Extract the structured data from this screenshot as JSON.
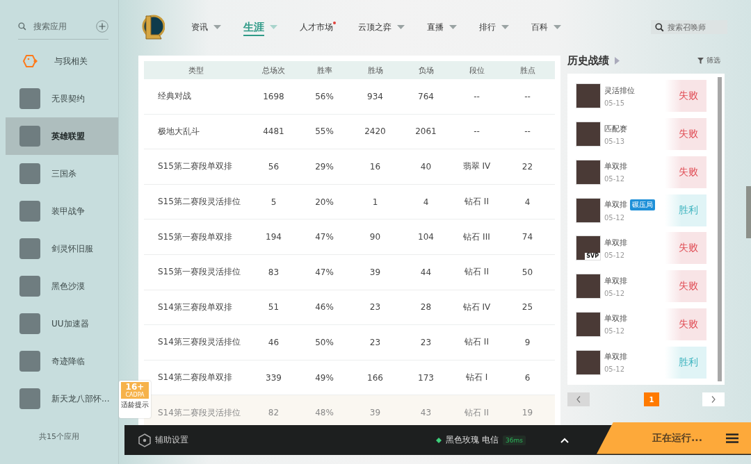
{
  "sidebar": {
    "search": {
      "placeholder": "搜索应用"
    },
    "items": [
      {
        "label": "与我相关",
        "selected": false,
        "kind": "related"
      },
      {
        "label": "无畏契约",
        "selected": false,
        "kind": "game"
      },
      {
        "label": "英雄联盟",
        "selected": true,
        "kind": "game"
      },
      {
        "label": "三国杀",
        "selected": false,
        "kind": "game"
      },
      {
        "label": "装甲战争",
        "selected": false,
        "kind": "game"
      },
      {
        "label": "剑灵怀旧服",
        "selected": false,
        "kind": "game"
      },
      {
        "label": "黑色沙漠",
        "selected": false,
        "kind": "game"
      },
      {
        "label": "UU加速器",
        "selected": false,
        "kind": "game"
      },
      {
        "label": "奇迹降临",
        "selected": false,
        "kind": "game"
      },
      {
        "label": "新天龙八部怀...",
        "selected": false,
        "kind": "game"
      }
    ],
    "footer": "共15个应用"
  },
  "nav": {
    "tabs": [
      {
        "label": "资讯",
        "selected": false,
        "menu": true,
        "dot": false
      },
      {
        "label": "生涯",
        "selected": true,
        "menu": true,
        "dot": false
      },
      {
        "label": "人才市场",
        "selected": false,
        "menu": false,
        "dot": true
      },
      {
        "label": "云顶之弈",
        "selected": false,
        "menu": true,
        "dot": false
      },
      {
        "label": "直播",
        "selected": false,
        "menu": true,
        "dot": false
      },
      {
        "label": "排行",
        "selected": false,
        "menu": true,
        "dot": false
      },
      {
        "label": "百科",
        "selected": false,
        "menu": true,
        "dot": false
      }
    ],
    "search": {
      "placeholder": "搜索召唤师"
    }
  },
  "table": {
    "columns": [
      "类型",
      "总场次",
      "胜率",
      "胜场",
      "负场",
      "段位",
      "胜点"
    ],
    "rows": [
      {
        "cells": [
          "经典对战",
          "1698",
          "56%",
          "934",
          "764",
          "--",
          "--"
        ],
        "hovered": false
      },
      {
        "cells": [
          "极地大乱斗",
          "4481",
          "55%",
          "2420",
          "2061",
          "--",
          "--"
        ],
        "hovered": false
      },
      {
        "cells": [
          "S15第二赛段单双排",
          "56",
          "29%",
          "16",
          "40",
          "翡翠 IV",
          "22"
        ],
        "hovered": false
      },
      {
        "cells": [
          "S15第二赛段灵活排位",
          "5",
          "20%",
          "1",
          "4",
          "钻石 II",
          "4"
        ],
        "hovered": false
      },
      {
        "cells": [
          "S15第一赛段单双排",
          "194",
          "47%",
          "90",
          "104",
          "钻石 III",
          "74"
        ],
        "hovered": false
      },
      {
        "cells": [
          "S15第一赛段灵活排位",
          "83",
          "47%",
          "39",
          "44",
          "钻石 II",
          "50"
        ],
        "hovered": false
      },
      {
        "cells": [
          "S14第三赛段单双排",
          "51",
          "46%",
          "23",
          "28",
          "钻石 IV",
          "25"
        ],
        "hovered": false
      },
      {
        "cells": [
          "S14第三赛段灵活排位",
          "46",
          "50%",
          "23",
          "23",
          "钻石 II",
          "9"
        ],
        "hovered": false
      },
      {
        "cells": [
          "S14第二赛段单双排",
          "339",
          "49%",
          "166",
          "173",
          "钻石 I",
          "6"
        ],
        "hovered": false
      },
      {
        "cells": [
          "S14第二赛段灵活排位",
          "82",
          "48%",
          "39",
          "43",
          "钻石 II",
          "19"
        ],
        "hovered": true
      }
    ]
  },
  "age_badge": {
    "rating": "16+",
    "org": "CADPA",
    "caption": "适龄提示"
  },
  "history": {
    "title": "历史战绩",
    "filter": "筛选",
    "matches": [
      {
        "mode": "灵活排位",
        "date": "05-15",
        "result": "失败",
        "kind": "loss"
      },
      {
        "mode": "匹配赛",
        "date": "05-13",
        "result": "失败",
        "kind": "loss"
      },
      {
        "mode": "单双排",
        "date": "05-12",
        "result": "失败",
        "kind": "loss"
      },
      {
        "mode": "单双排",
        "tag": "碾压局",
        "date": "05-12",
        "result": "胜利",
        "kind": "win"
      },
      {
        "mode": "单双排",
        "badge": "SVP",
        "date": "05-12",
        "result": "失败",
        "kind": "loss"
      },
      {
        "mode": "单双排",
        "date": "05-12",
        "result": "失败",
        "kind": "loss"
      },
      {
        "mode": "单双排",
        "date": "05-12",
        "result": "失败",
        "kind": "loss"
      },
      {
        "mode": "单双排",
        "date": "05-12",
        "result": "胜利",
        "kind": "win"
      }
    ],
    "pages": [
      {
        "label": "1",
        "selected": true
      }
    ]
  },
  "bottom_bar": {
    "settings": "辅助设置",
    "server": "黑色玫瑰 电信",
    "ping": "36ms",
    "status": "正在运行..."
  }
}
